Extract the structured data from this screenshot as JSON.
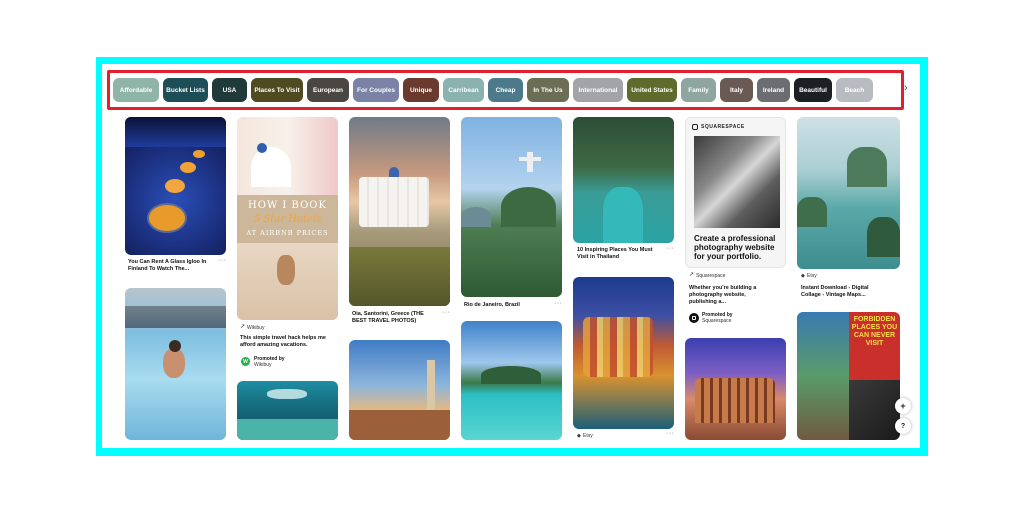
{
  "categories": [
    {
      "label": "Affordable",
      "color": "#8fb4a8"
    },
    {
      "label": "Bucket Lists",
      "color": "#1d4e57"
    },
    {
      "label": "USA",
      "color": "#1f3a38"
    },
    {
      "label": "Places To Visit",
      "color": "#4f4a1f"
    },
    {
      "label": "European",
      "color": "#4a4743"
    },
    {
      "label": "For Couples",
      "color": "#7a83a6"
    },
    {
      "label": "Unique",
      "color": "#6b3a2f"
    },
    {
      "label": "Carribean",
      "color": "#8ab2ae"
    },
    {
      "label": "Cheap",
      "color": "#4d7a8a"
    },
    {
      "label": "In The Us",
      "color": "#6b6e55"
    },
    {
      "label": "International",
      "color": "#a2a4a8"
    },
    {
      "label": "United States",
      "color": "#5e6b2c"
    },
    {
      "label": "Family",
      "color": "#8fa6a0"
    },
    {
      "label": "Italy",
      "color": "#6a5a53"
    },
    {
      "label": "Ireland",
      "color": "#6b6d71"
    },
    {
      "label": "Beautiful",
      "color": "#1d2023"
    },
    {
      "label": "Beach",
      "color": "#b8bcc0"
    }
  ],
  "pins": {
    "igloo": {
      "caption": "You Can Rent A Glass Igloo In Finland To Watch The..."
    },
    "wikibuy": {
      "overlay_line1": "HOW I BOOK",
      "overlay_line2": "5 Star Hotels",
      "overlay_line3": "AT AIRBNB PRICES",
      "source": "Wikibuy",
      "caption": "This simple travel hack helps me afford amazing vacations.",
      "promoted": "Promoted by",
      "promoter": "Wikibuy",
      "avatar_letter": "W"
    },
    "santorini": {
      "caption": "Oia, Santorini, Greece (THE BEST TRAVEL PHOTOS)"
    },
    "rio": {
      "caption": "Rio de Janeiro, Brazil"
    },
    "thailand": {
      "caption": "10 Inspiring Places You Must Visit in Thailand"
    },
    "squarespace": {
      "brand": "SQUARESPACE",
      "headline": "Create a professional photography website for your portfolio.",
      "source": "Squarespace",
      "caption": "Whether you're building a photography website, publishing a...",
      "promoted": "Promoted by",
      "promoter": "Squarespace"
    },
    "collage": {
      "source": "Etsy",
      "caption": "Instant Download - Digital Collage - Vintage Maps..."
    },
    "cinque": {
      "source": "Etsy"
    },
    "forbidden": {
      "text": "FORBIDDEN PLACES YOU CAN NEVER VISIT"
    }
  },
  "controls": {
    "dots": "···",
    "chevron": "›",
    "plus": "+",
    "help": "?"
  }
}
